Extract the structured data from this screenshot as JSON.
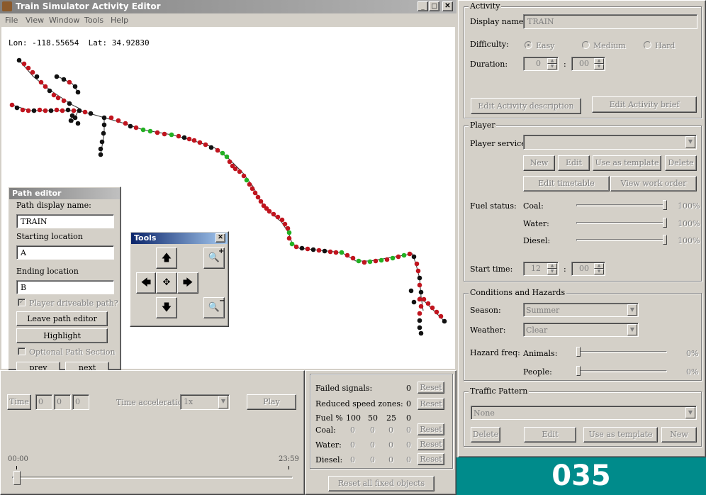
{
  "window": {
    "title": "Train Simulator Activity Editor"
  },
  "menu": [
    "File",
    "View",
    "Window",
    "Tools",
    "Help"
  ],
  "map": {
    "coords": "Lon: -118.55654  Lat: 34.92830"
  },
  "path_editor": {
    "title": "Path editor",
    "display_name_label": "Path display name:",
    "display_name_value": "TRAIN",
    "start_label": "Starting location",
    "start_value": "A",
    "end_label": "Ending location",
    "end_value": "B",
    "player_drivable_label": "Player driveable path?",
    "leave_button": "Leave path editor",
    "highlight_button": "Highlight",
    "optional_label": "Optional Path Section",
    "prev_button": "prev",
    "next_button": "next"
  },
  "tools": {
    "title": "Tools"
  },
  "timeline": {
    "time_button": "Time",
    "time_fields": [
      "0",
      "0",
      "0"
    ],
    "accel_label": "Time acceleration",
    "accel_value": "1x",
    "play_button": "Play",
    "start_time": "00:00",
    "end_time": "23:59",
    "position": 0
  },
  "failures": {
    "failed_signals_label": "Failed signals:",
    "failed_signals_value": "0",
    "reduced_speed_label": "Reduced speed zones:",
    "reduced_speed_value": "0",
    "fuel_header": [
      "Fuel %",
      "100",
      "50",
      "25",
      "0"
    ],
    "rows": [
      {
        "label": "Coal:",
        "values": [
          "0",
          "0",
          "0",
          "0"
        ]
      },
      {
        "label": "Water:",
        "values": [
          "0",
          "0",
          "0",
          "0"
        ]
      },
      {
        "label": "Diesel:",
        "values": [
          "0",
          "0",
          "0",
          "0"
        ]
      }
    ],
    "reset_label": "Reset",
    "reset_all": "Reset all fixed objects"
  },
  "activity": {
    "title": "Activity",
    "display_name_label": "Display name:",
    "display_name_value": "TRAIN",
    "difficulty_label": "Difficulty:",
    "difficulty_options": [
      "Easy",
      "Medium",
      "Hard"
    ],
    "difficulty_selected": "Easy",
    "duration_label": "Duration:",
    "duration_hours": "0",
    "duration_minutes": "00",
    "edit_description": "Edit Activity description",
    "edit_brief": "Edit Activity brief"
  },
  "player": {
    "title": "Player",
    "service_label": "Player service:",
    "service_value": "",
    "btn_new": "New",
    "btn_edit": "Edit",
    "btn_template": "Use as template",
    "btn_delete": "Delete",
    "btn_timetable": "Edit timetable",
    "btn_workorder": "View work order",
    "fuel_label": "Fuel status:",
    "fuel": [
      {
        "name": "Coal:",
        "value": "100%",
        "level": 1.0
      },
      {
        "name": "Water:",
        "value": "100%",
        "level": 1.0
      },
      {
        "name": "Diesel:",
        "value": "100%",
        "level": 1.0
      }
    ],
    "start_label": "Start time:",
    "start_hours": "12",
    "start_minutes": "00"
  },
  "conditions": {
    "title": "Conditions and Hazards",
    "season_label": "Season:",
    "season_value": "Summer",
    "weather_label": "Weather:",
    "weather_value": "Clear",
    "hazard_label": "Hazard freq:",
    "animals_label": "Animals:",
    "animals_value": "0%",
    "people_label": "People:",
    "people_value": "0%"
  },
  "traffic": {
    "title": "Traffic Pattern",
    "value": "None",
    "btn_delete": "Delete",
    "btn_edit": "Edit",
    "btn_template": "Use as template",
    "btn_new": "New"
  },
  "overlay": {
    "counter": "035",
    "color": "#008b8b"
  }
}
